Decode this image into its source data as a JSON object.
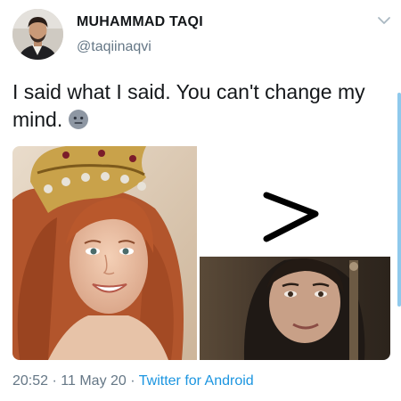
{
  "header": {
    "display_name": "MUHAMMAD TAQI",
    "handle": "@taqiinaqvi"
  },
  "tweet": {
    "text": "I said what I said. You can't change my mind.",
    "emoji": "neutral-face-emoji"
  },
  "media": {
    "symbol": ">",
    "left_image": "smiling-red-haired-woman-with-crown",
    "right_image": "smiling-dark-haired-woman"
  },
  "meta": {
    "time": "20:52",
    "separator": "·",
    "date": "11 May 20",
    "source": "Twitter for Android"
  },
  "colors": {
    "text": "#14171a",
    "secondary": "#657786",
    "link": "#1b95e0"
  }
}
